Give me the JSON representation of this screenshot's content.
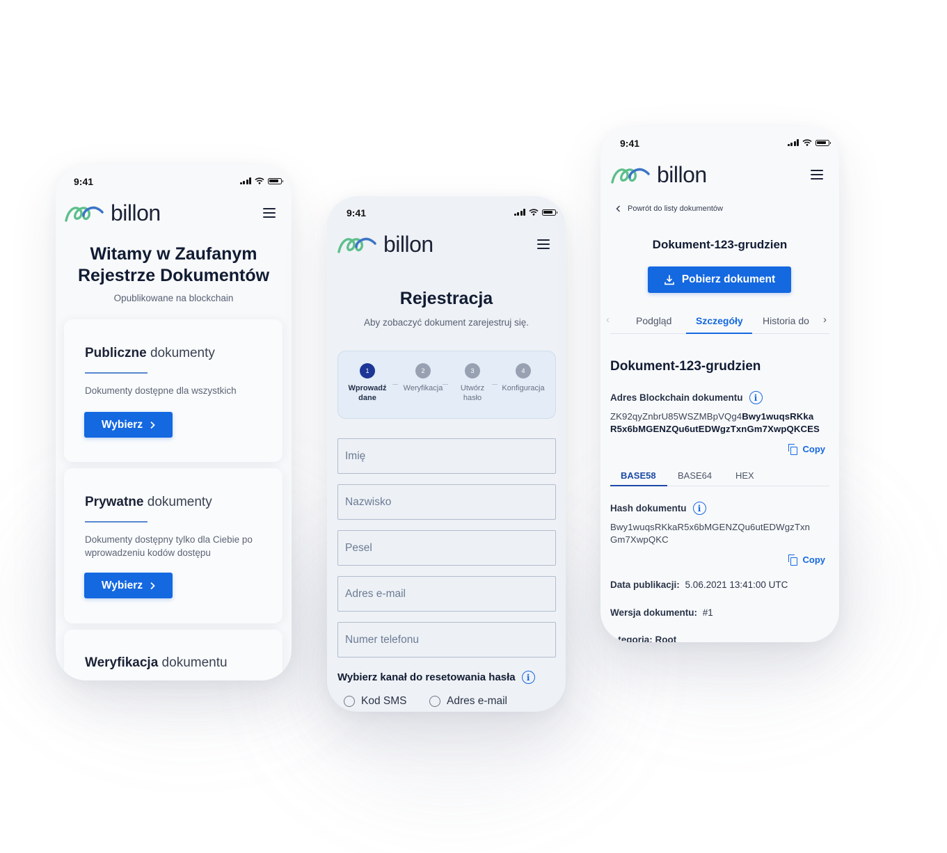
{
  "brand": {
    "name": "billon",
    "logo_colors": [
      "#5cbf8a",
      "#3b73c9"
    ]
  },
  "status_bar": {
    "time": "9:41"
  },
  "accent": "#1468e0",
  "home": {
    "title_line1": "Witamy w Zaufanym",
    "title_line2": "Rejestrze Dokumentów",
    "subtitle": "Opublikowane na blockchain",
    "cards": [
      {
        "title_bold": "Publiczne",
        "title_rest": " dokumenty",
        "description": "Dokumenty dostępne dla wszystkich",
        "button": "Wybierz"
      },
      {
        "title_bold": "Prywatne",
        "title_rest": " dokumenty",
        "description": "Dokumenty dostępny tylko dla Ciebie po wprowadzeniu kodów dostępu",
        "button": "Wybierz"
      },
      {
        "title_bold": "Weryfikacja",
        "title_rest": " dokumentu"
      }
    ]
  },
  "register": {
    "title": "Rejestracja",
    "subtitle": "Aby zobaczyć dokument zarejestruj się.",
    "steps": [
      {
        "num": "1",
        "label_line1": "Wprowadź",
        "label_line2": "dane"
      },
      {
        "num": "2",
        "label_line1": "Weryfikacja",
        "label_line2": ""
      },
      {
        "num": "3",
        "label_line1": "Utwórz",
        "label_line2": "hasło"
      },
      {
        "num": "4",
        "label_line1": "Konfiguracja",
        "label_line2": ""
      }
    ],
    "active_step": 1,
    "fields": [
      {
        "placeholder": "Imię"
      },
      {
        "placeholder": "Nazwisko"
      },
      {
        "placeholder": "Pesel"
      },
      {
        "placeholder": "Adres e-mail"
      },
      {
        "placeholder": "Numer telefonu"
      }
    ],
    "reset_title": "Wybierz kanał do resetowania hasła",
    "reset_options": [
      "Kod SMS",
      "Adres e-mail"
    ]
  },
  "document": {
    "back_link": "Powrót do listy dokumentów",
    "name": "Dokument-123-grudzien",
    "download_button": "Pobierz dokument",
    "tabs": [
      "Podgląd",
      "Szczegóły",
      "Historia do"
    ],
    "active_tab": "Szczegóły",
    "blockchain_label": "Adres Blockchain dokumentu",
    "blockchain_addr_line1_plain": "ZK92qyZnbrU85WSZMBpVQg4",
    "blockchain_addr_line1_bold": "Bwy1wuqsRKka",
    "blockchain_addr_line2_bold": "R5x6bMGENZQu6utEDWgzTxnGm7XwpQKCES",
    "copy_label": "Copy",
    "encodings": [
      "BASE58",
      "BASE64",
      "HEX"
    ],
    "active_encoding": "BASE58",
    "hash_label": "Hash dokumentu",
    "hash_line1": "Bwy1wuqsRKkaR5x6bMGENZQu6utEDWgzTxn",
    "hash_line2": "Gm7XwpQKC",
    "published_label": "Data publikacji:",
    "published_value": "5.06.2021 13:41:00 UTC",
    "version_label": "Wersja dokumentu:",
    "version_value": "#1",
    "category_partial": "...tegoria:  Root"
  }
}
